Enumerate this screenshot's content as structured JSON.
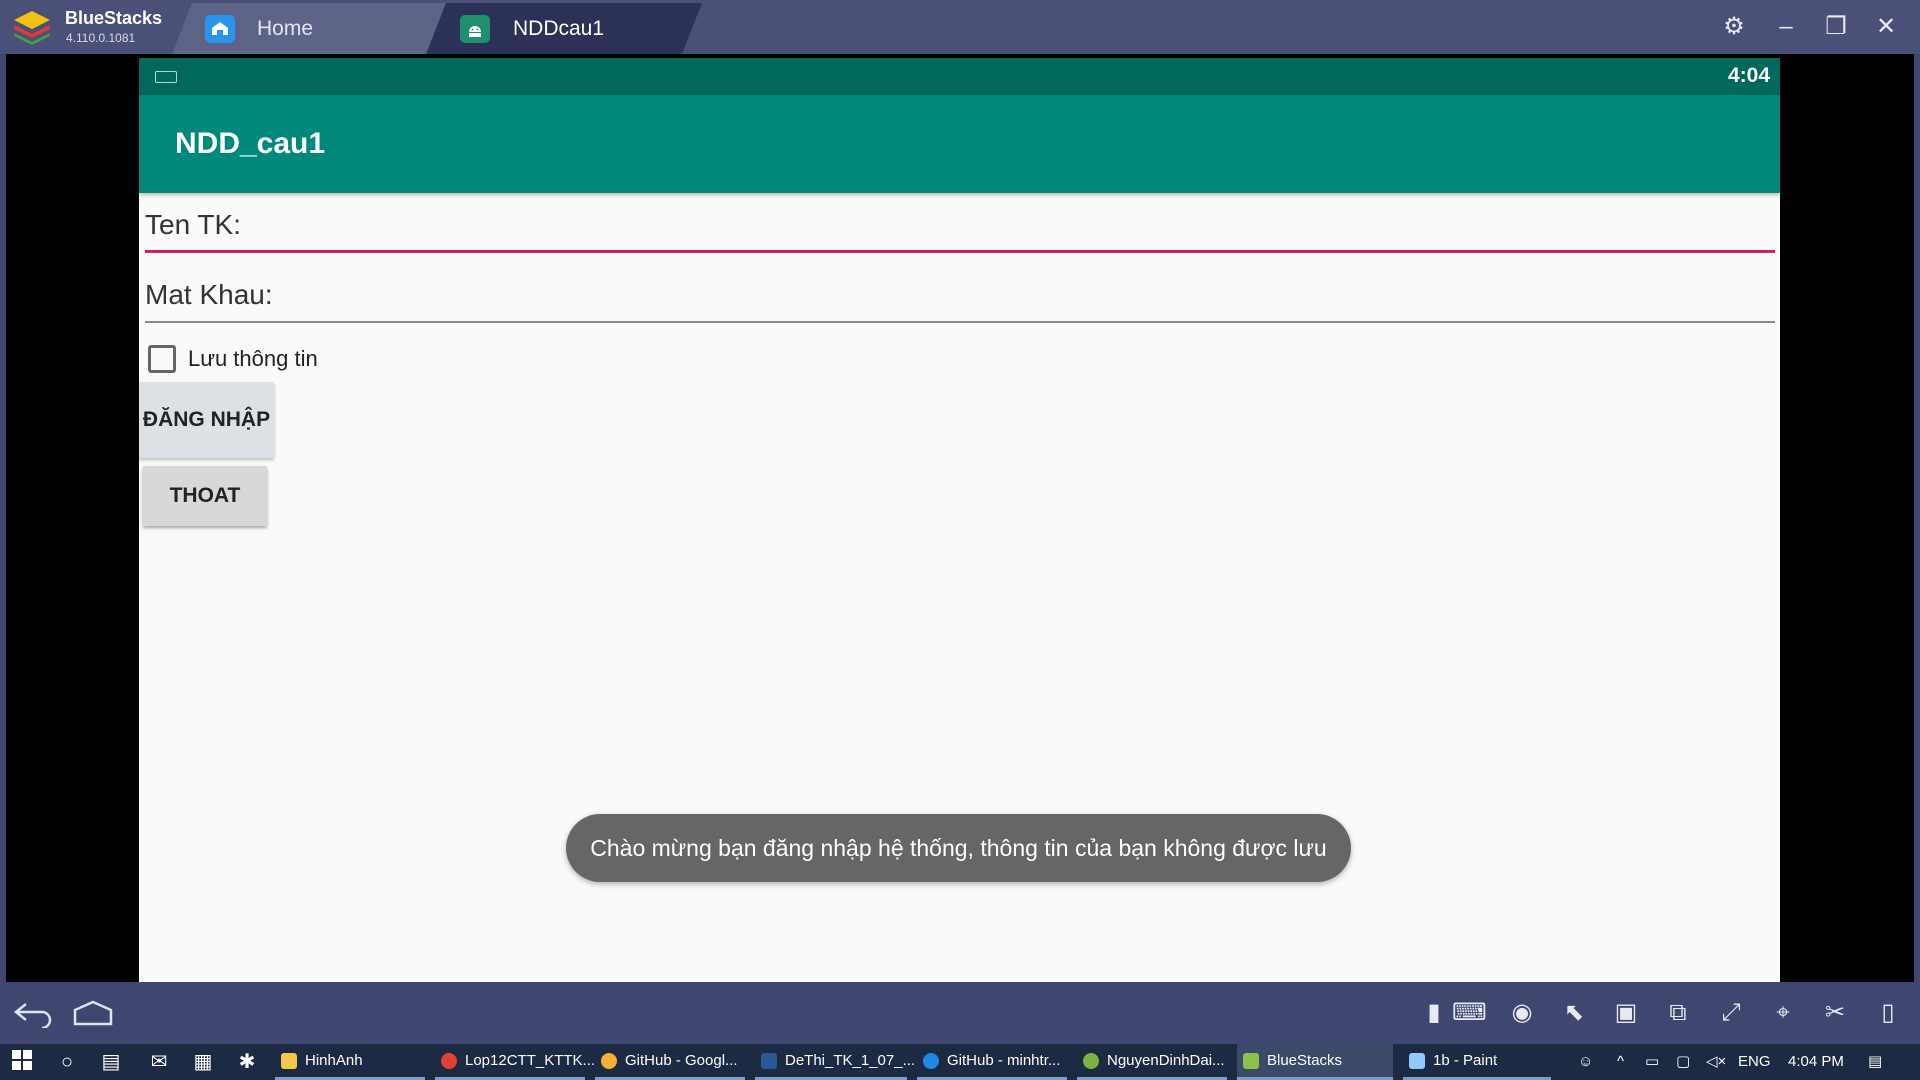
{
  "titlebar": {
    "brand": "BlueStacks",
    "version": "4.110.0.1081",
    "tabs": [
      {
        "label": "Home"
      },
      {
        "label": "NDDcau1"
      }
    ]
  },
  "android": {
    "status_time": "4:04",
    "app_title": "NDD_cau1",
    "username_hint": "Ten TK:",
    "password_hint": "Mat Khau:",
    "remember_label": "Lưu thông tin",
    "remember_checked": false,
    "login_button": "ĐĂNG NHẬP",
    "exit_button": "THOAT",
    "toast": "Chào mừng bạn đăng nhập hệ thống, thông tin của bạn không được lưu",
    "colors": {
      "status": "#00695c",
      "actionbar": "#00897b",
      "accent": "#d81b60"
    }
  },
  "taskbar": {
    "tasks": [
      {
        "label": "HinhAnh"
      },
      {
        "label": "Lop12CTT_KTTK..."
      },
      {
        "label": "GitHub - Googl..."
      },
      {
        "label": "DeThi_TK_1_07_..."
      },
      {
        "label": "GitHub - minhtr..."
      },
      {
        "label": "NguyenDinhDai..."
      },
      {
        "label": "BlueStacks"
      },
      {
        "label": "1b - Paint"
      }
    ],
    "language": "ENG",
    "time": "4:04 PM"
  }
}
